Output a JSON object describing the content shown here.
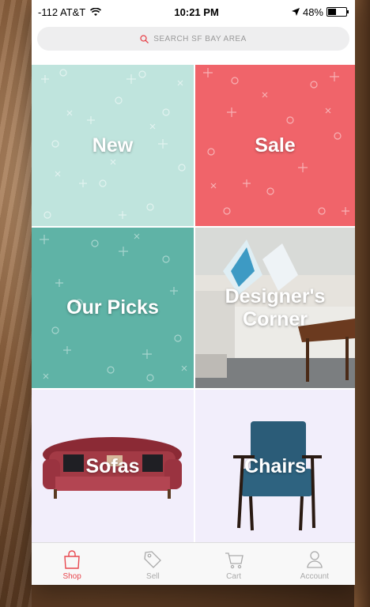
{
  "status": {
    "carrier": "-112 AT&T",
    "time": "10:21 PM",
    "battery": "48%",
    "battery_level": 0.48
  },
  "search": {
    "placeholder": "SEARCH SF BAY AREA"
  },
  "tiles": [
    {
      "label": "New",
      "color": "#bfe4dd"
    },
    {
      "label": "Sale",
      "color": "#f0646a"
    },
    {
      "label": "Our Picks",
      "color": "#5fb3a6"
    },
    {
      "label_line1": "Designer's",
      "label_line2": "Corner"
    },
    {
      "label": "Sofas"
    },
    {
      "label": "Chairs"
    }
  ],
  "tabs": [
    {
      "label": "Shop",
      "icon": "shopping-bag-icon",
      "active": true
    },
    {
      "label": "Sell",
      "icon": "price-tag-icon"
    },
    {
      "label": "Cart",
      "icon": "cart-icon"
    },
    {
      "label": "Account",
      "icon": "user-icon"
    }
  ],
  "colors": {
    "accent": "#e8474e"
  }
}
